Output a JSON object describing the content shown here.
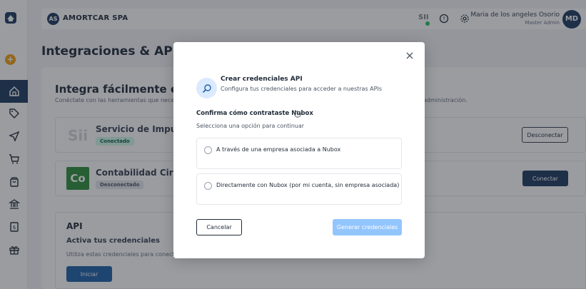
{
  "header": {
    "company_initials": "AS",
    "company_name": "AMORTCAR SPA",
    "sii_label": "SII",
    "user_name": "Maria de los angeles Osorio",
    "user_role": "Master Admin",
    "user_initials": "MD"
  },
  "page": {
    "title": "Integraciones & API"
  },
  "integrations": {
    "heading": "Integra fácilmente el SII, ",
    "description": "Conéctate con las herramientas que necesitas",
    "description_end": "administración.",
    "services": [
      {
        "logo_text": "Sii",
        "name": "Servicio de Impuestos",
        "status": "Conectado",
        "action": "Desconectar"
      },
      {
        "logo_text": "Co",
        "name": "Contabilidad Cirrus",
        "status": "Desconectado",
        "action": "Conectar"
      }
    ]
  },
  "api": {
    "title": "API",
    "subtitle": "Activa tus credenciales",
    "description": "Utiliza estas credenciales para conectarte",
    "start_label": "Iniciar"
  },
  "modal": {
    "title": "Crear credenciales API",
    "subtitle": "Configura tus credenciales para acceder a nuestras APIs",
    "confirm_label": "Confirma cómo contrataste Nubox",
    "select_hint": "Selecciona una opción para continuar",
    "options": [
      {
        "label": "A través de una empresa asociada a Nubox"
      },
      {
        "label": "Directamente con Nubox (por mi cuenta, sin empresa asociada)"
      }
    ],
    "cancel_label": "Cancelar",
    "generate_label": "Generar credenciales"
  },
  "colors": {
    "brand": "#1e3a5f",
    "accent_light": "#93c5fd",
    "success": "#22c55e"
  }
}
